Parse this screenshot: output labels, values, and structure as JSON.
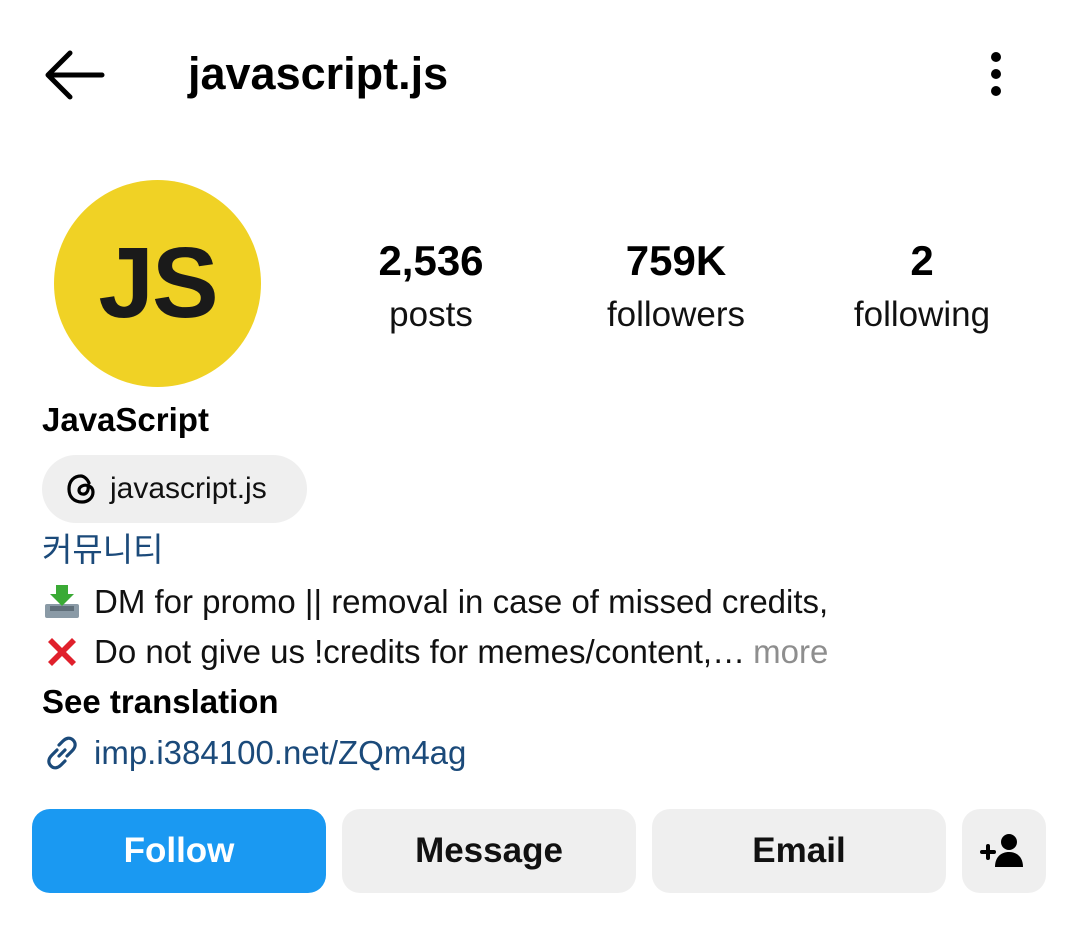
{
  "header": {
    "username": "javascript.js",
    "back_icon": "arrow-left-icon",
    "more_icon": "more-vertical-icon"
  },
  "profile": {
    "avatar_text": "JS",
    "avatar_color": "#f0d225",
    "display_name": "JavaScript",
    "threads_handle": "javascript.js",
    "category": "커뮤니티",
    "bio_line_1": "DM for promo || removal in case of missed credits,",
    "bio_line_2": "Do not give us !credits for memes/content,…",
    "more_label": "more",
    "see_translation": "See translation",
    "link": "imp.i384100.net/ZQm4ag"
  },
  "stats": [
    {
      "value": "2,536",
      "label": "posts"
    },
    {
      "value": "759K",
      "label": "followers"
    },
    {
      "value": "2",
      "label": "following"
    }
  ],
  "actions": {
    "follow": "Follow",
    "message": "Message",
    "email": "Email",
    "add_icon": "add-person-icon"
  },
  "colors": {
    "accent": "#1a99f2",
    "link": "#1b4a7a"
  }
}
